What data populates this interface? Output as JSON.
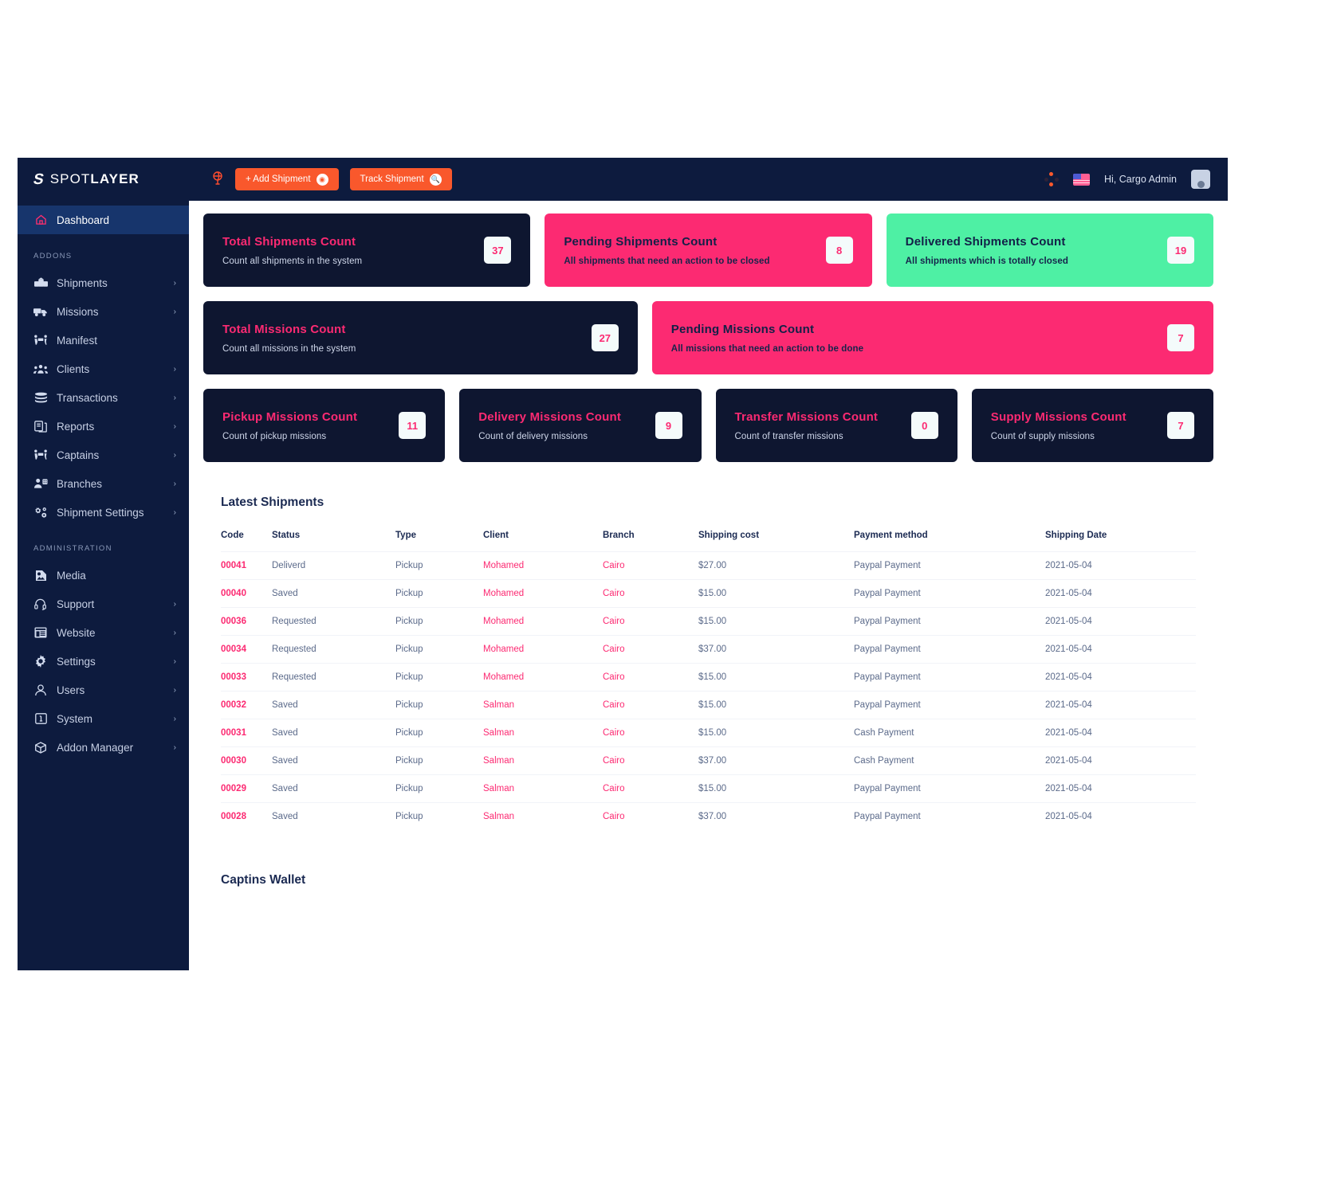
{
  "brand": {
    "mark": "S",
    "name_light": "SPOT",
    "name_bold": "LAYER"
  },
  "topbar": {
    "globe_icon": "globe-icon",
    "add_shipment_label": "+ Add Shipment",
    "track_shipment_label": "Track Shipment",
    "apps_icon": "apps-grid-icon",
    "flag_icon": "us-flag-icon",
    "greeting": "Hi, Cargo Admin",
    "avatar_icon": "user-avatar"
  },
  "sidebar": {
    "dashboard": {
      "label": "Dashboard",
      "icon": "home-icon"
    },
    "section_addons": "ADDONS",
    "section_administration": "ADMINISTRATION",
    "addons": [
      {
        "label": "Shipments",
        "icon": "box-icon",
        "chevron": "›"
      },
      {
        "label": "Missions",
        "icon": "truck-icon",
        "chevron": "›"
      },
      {
        "label": "Manifest",
        "icon": "people-carry-icon",
        "chevron": ""
      },
      {
        "label": "Clients",
        "icon": "users-group-icon",
        "chevron": "›"
      },
      {
        "label": "Transactions",
        "icon": "coins-icon",
        "chevron": "›"
      },
      {
        "label": "Reports",
        "icon": "documents-icon",
        "chevron": "›"
      },
      {
        "label": "Captains",
        "icon": "people-carry-icon",
        "chevron": "›"
      },
      {
        "label": "Branches",
        "icon": "branch-users-icon",
        "chevron": "›"
      },
      {
        "label": "Shipment Settings",
        "icon": "gears-icon",
        "chevron": "›"
      }
    ],
    "administration": [
      {
        "label": "Media",
        "icon": "media-file-icon",
        "chevron": ""
      },
      {
        "label": "Support",
        "icon": "headset-icon",
        "chevron": "›"
      },
      {
        "label": "Website",
        "icon": "browser-window-icon",
        "chevron": "›"
      },
      {
        "label": "Settings",
        "icon": "gear-icon",
        "chevron": "›"
      },
      {
        "label": "Users",
        "icon": "user-icon",
        "chevron": "›"
      },
      {
        "label": "System",
        "icon": "system-info-icon",
        "chevron": "›"
      },
      {
        "label": "Addon Manager",
        "icon": "package-icon",
        "chevron": "›"
      }
    ]
  },
  "stats": {
    "total_shipments": {
      "title": "Total Shipments Count",
      "subtitle": "Count all shipments in the system",
      "value": "37"
    },
    "pending_shipments": {
      "title": "Pending Shipments Count",
      "subtitle": "All shipments that need an action to be closed",
      "value": "8"
    },
    "delivered_shipments": {
      "title": "Delivered Shipments Count",
      "subtitle": "All shipments which is totally closed",
      "value": "19"
    },
    "total_missions": {
      "title": "Total Missions Count",
      "subtitle": "Count all missions in the system",
      "value": "27"
    },
    "pending_missions": {
      "title": "Pending Missions Count",
      "subtitle": "All missions that need an action to be done",
      "value": "7"
    },
    "pickup_missions": {
      "title": "Pickup Missions Count",
      "subtitle": "Count of pickup missions",
      "value": "11"
    },
    "delivery_missions": {
      "title": "Delivery Missions Count",
      "subtitle": "Count of delivery missions",
      "value": "9"
    },
    "transfer_missions": {
      "title": "Transfer Missions Count",
      "subtitle": "Count of transfer missions",
      "value": "0"
    },
    "supply_missions": {
      "title": "Supply Missions Count",
      "subtitle": "Count of supply missions",
      "value": "7"
    }
  },
  "latest_shipments": {
    "title": "Latest Shipments",
    "columns": [
      "Code",
      "Status",
      "Type",
      "Client",
      "Branch",
      "Shipping cost",
      "Payment method",
      "Shipping Date"
    ],
    "rows": [
      {
        "code": "00041",
        "status": "Deliverd",
        "type": "Pickup",
        "client": "Mohamed",
        "branch": "Cairo",
        "cost": "$27.00",
        "payment": "Paypal Payment",
        "date": "2021-05-04"
      },
      {
        "code": "00040",
        "status": "Saved",
        "type": "Pickup",
        "client": "Mohamed",
        "branch": "Cairo",
        "cost": "$15.00",
        "payment": "Paypal Payment",
        "date": "2021-05-04"
      },
      {
        "code": "00036",
        "status": "Requested",
        "type": "Pickup",
        "client": "Mohamed",
        "branch": "Cairo",
        "cost": "$15.00",
        "payment": "Paypal Payment",
        "date": "2021-05-04"
      },
      {
        "code": "00034",
        "status": "Requested",
        "type": "Pickup",
        "client": "Mohamed",
        "branch": "Cairo",
        "cost": "$37.00",
        "payment": "Paypal Payment",
        "date": "2021-05-04"
      },
      {
        "code": "00033",
        "status": "Requested",
        "type": "Pickup",
        "client": "Mohamed",
        "branch": "Cairo",
        "cost": "$15.00",
        "payment": "Paypal Payment",
        "date": "2021-05-04"
      },
      {
        "code": "00032",
        "status": "Saved",
        "type": "Pickup",
        "client": "Salman",
        "branch": "Cairo",
        "cost": "$15.00",
        "payment": "Paypal Payment",
        "date": "2021-05-04"
      },
      {
        "code": "00031",
        "status": "Saved",
        "type": "Pickup",
        "client": "Salman",
        "branch": "Cairo",
        "cost": "$15.00",
        "payment": "Cash Payment",
        "date": "2021-05-04"
      },
      {
        "code": "00030",
        "status": "Saved",
        "type": "Pickup",
        "client": "Salman",
        "branch": "Cairo",
        "cost": "$37.00",
        "payment": "Cash Payment",
        "date": "2021-05-04"
      },
      {
        "code": "00029",
        "status": "Saved",
        "type": "Pickup",
        "client": "Salman",
        "branch": "Cairo",
        "cost": "$15.00",
        "payment": "Paypal Payment",
        "date": "2021-05-04"
      },
      {
        "code": "00028",
        "status": "Saved",
        "type": "Pickup",
        "client": "Salman",
        "branch": "Cairo",
        "cost": "$37.00",
        "payment": "Paypal Payment",
        "date": "2021-05-04"
      }
    ]
  },
  "captains_wallet": {
    "title": "Captins Wallet"
  },
  "colors": {
    "sidebar_bg": "#0d1b3e",
    "card_dark": "#0e1630",
    "accent_pink": "#fc2a72",
    "accent_green": "#4ef0a4",
    "accent_orange": "#f9582c",
    "active_nav": "#17356c"
  }
}
